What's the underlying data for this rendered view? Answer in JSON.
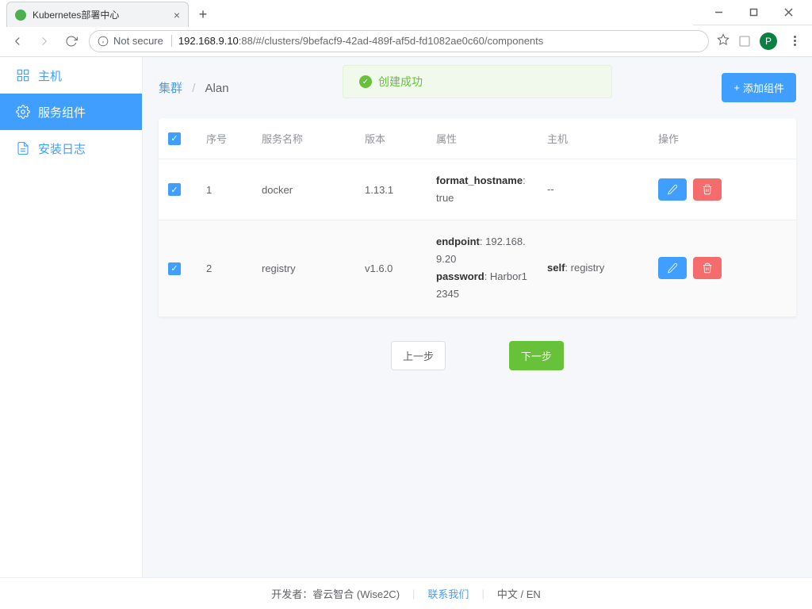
{
  "window": {
    "tab_title": "Kubernetes部署中心",
    "insecure_label": "Not secure",
    "url_host": "192.168.9.10",
    "url_port": ":88",
    "url_path": "/#/clusters/9befacf9-42ad-489f-af5d-fd1082ae0c60/components",
    "avatar_letter": "P"
  },
  "sidebar": {
    "hosts": "主机",
    "components": "服务组件",
    "logs": "安装日志"
  },
  "breadcrumb": {
    "root": "集群",
    "sep": "/",
    "current": "Alan"
  },
  "toast": "创建成功",
  "add_button": "添加组件",
  "table": {
    "headers": {
      "index": "序号",
      "name": "服务名称",
      "version": "版本",
      "props": "属性",
      "host": "主机",
      "ops": "操作"
    },
    "rows": [
      {
        "index": "1",
        "name": "docker",
        "version": "1.13.1",
        "props_html": "<b>format_hostname</b>: true",
        "host": "--"
      },
      {
        "index": "2",
        "name": "registry",
        "version": "v1.6.0",
        "props_html": "<b>endpoint</b>: 192.168.9.20<br><b>password</b>: Harbor12345",
        "host": "<b>self</b>: registry"
      }
    ]
  },
  "pager": {
    "prev": "上一步",
    "next": "下一步"
  },
  "footer": {
    "dev_label": "开发者：",
    "dev_name": "睿云智合 (Wise2C)",
    "contact": "联系我们",
    "lang_zh": "中文",
    "lang_sep": " / ",
    "lang_en": "EN"
  }
}
